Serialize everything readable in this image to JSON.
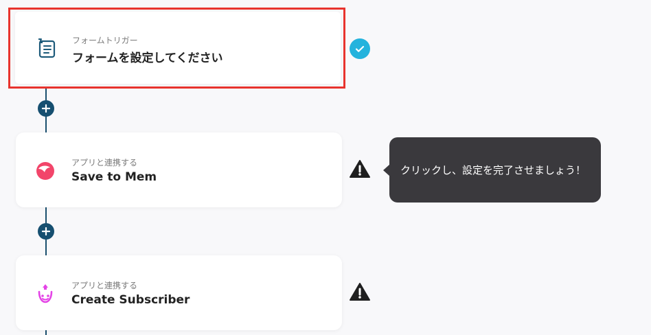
{
  "steps": [
    {
      "sub": "フォームトリガー",
      "title": "フォームを設定してください",
      "icon": "form-trigger-icon",
      "status": "complete"
    },
    {
      "sub": "アプリと連携する",
      "title": "Save to Mem",
      "icon": "mem-logo-icon",
      "status": "warning"
    },
    {
      "sub": "アプリと連携する",
      "title": "Create Subscriber",
      "icon": "drip-logo-icon",
      "status": "warning"
    }
  ],
  "tooltip": {
    "text": "クリックし、設定を完了させましょう！"
  },
  "colors": {
    "selected_border": "#e8332d",
    "check": "#24b3dd",
    "connector": "#164f70",
    "tooltip_bg": "#3a393d",
    "mem_brand": "#f2456a",
    "drip_brand": "#e443e6"
  }
}
